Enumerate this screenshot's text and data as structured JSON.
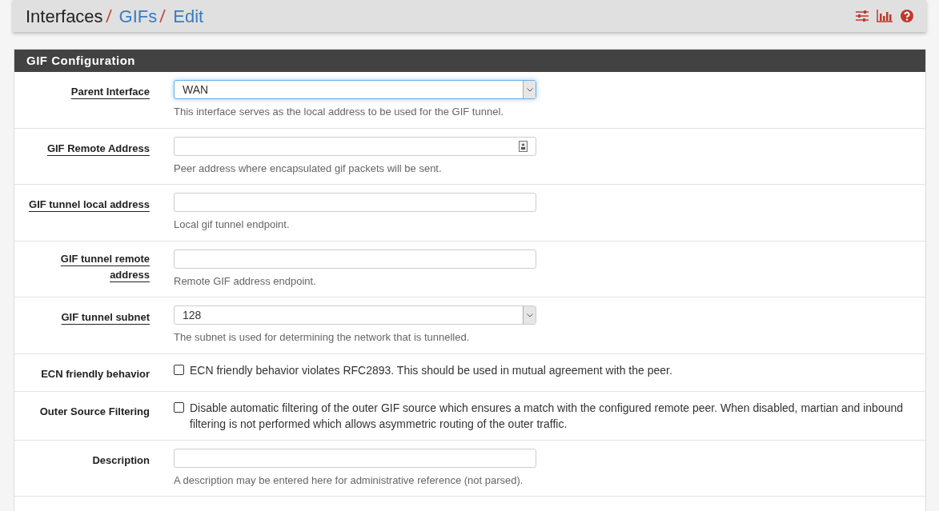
{
  "breadcrumb": [
    {
      "label": "Interfaces",
      "link": false
    },
    {
      "label": "GIFs",
      "link": true
    },
    {
      "label": "Edit",
      "link": true
    }
  ],
  "panel": {
    "title": "GIF Configuration"
  },
  "fields": [
    {
      "kind": "select",
      "label": "Parent Interface",
      "help_link": true,
      "value": "WAN",
      "focused": true,
      "hint": "This interface serves as the local address to be used for the GIF tunnel."
    },
    {
      "kind": "address_input",
      "label": "GIF Remote Address",
      "help_link": true,
      "focused": false,
      "hint": "Peer address where encapsulated gif packets will be sent."
    },
    {
      "kind": "input",
      "label": "GIF tunnel local address",
      "help_link": true,
      "focused": false,
      "hint": "Local gif tunnel endpoint."
    },
    {
      "kind": "input",
      "label": "GIF tunnel remote address",
      "help_link": true,
      "focused": false,
      "hint": "Remote GIF address endpoint."
    },
    {
      "kind": "select",
      "label": "GIF tunnel subnet",
      "help_link": true,
      "value": "128",
      "focused": false,
      "hint": "The subnet is used for determining the network that is tunnelled."
    },
    {
      "kind": "checkbox",
      "label": "ECN friendly behavior",
      "help_link": false,
      "checked": false,
      "text": "ECN friendly behavior violates RFC2893. This should be used in mutual agreement with the peer."
    },
    {
      "kind": "checkbox",
      "label": "Outer Source Filtering",
      "help_link": false,
      "checked": false,
      "text": "Disable automatic filtering of the outer GIF source which ensures a match with the configured remote peer. When disabled, martian and inbound filtering is not performed which allows asymmetric routing of the outer traffic."
    },
    {
      "kind": "input",
      "label": "Description",
      "help_link": false,
      "focused": false,
      "hint": "A description may be entered here for administrative reference (not parsed)."
    }
  ]
}
